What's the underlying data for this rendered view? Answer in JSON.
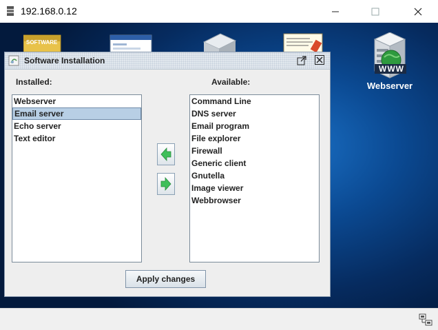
{
  "window": {
    "title": "192.168.0.12"
  },
  "desktop": {
    "webserver_icon_label": "Webserver",
    "partial_icon_text": "SOFTWARE"
  },
  "dialog": {
    "title": "Software Installation",
    "installed_label": "Installed:",
    "available_label": "Available:",
    "installed_items": [
      "Webserver",
      "Email server",
      "Echo server",
      "Text editor"
    ],
    "selected_installed_item": "Email server",
    "available_items": [
      "Command Line",
      "DNS server",
      "Email program",
      "File explorer",
      "Firewall",
      "Generic client",
      "Gnutella",
      "Image viewer",
      "Webbrowser"
    ],
    "apply_button_label": "Apply changes"
  },
  "colors": {
    "selection": "#b8cfe5",
    "desktop_blue": "#0b4a93",
    "arrow_green": "#3fbf5a"
  }
}
